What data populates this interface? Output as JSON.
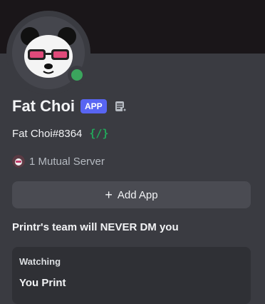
{
  "profile": {
    "display_name": "Fat Choi",
    "app_badge": "APP",
    "username": "Fat Choi#8364",
    "slash_commands_icon": "{/}",
    "mutual_servers": "1 Mutual Server",
    "status_color": "#3ba55d",
    "icons": [
      "panda-avatar-icon",
      "note-icon",
      "slash-command-icon",
      "server-icon",
      "plus-icon"
    ]
  },
  "actions": {
    "add_app": "Add App"
  },
  "notice": "Printr's team will NEVER DM you",
  "activity": {
    "label": "Watching",
    "name": "You Print"
  }
}
